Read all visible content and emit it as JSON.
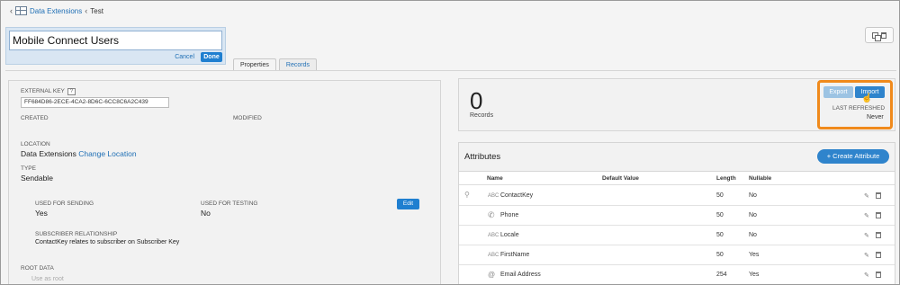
{
  "breadcrumb": {
    "parent": "Data Extensions",
    "current": "Test"
  },
  "title_editor": {
    "value": "Mobile Connect Users",
    "cancel_label": "Cancel",
    "done_label": "Done"
  },
  "tabs": [
    {
      "label": "Properties",
      "active": true
    },
    {
      "label": "Records",
      "active": false
    }
  ],
  "properties": {
    "external_key_label": "EXTERNAL KEY",
    "help_glyph": "?",
    "external_key_value": "FF684D86-2ECE-4CA2-8D6C-6CC8C6A2C439",
    "created_label": "CREATED",
    "modified_label": "MODIFIED",
    "location_label": "LOCATION",
    "location_value": "Data Extensions",
    "change_location_label": "Change Location",
    "type_label": "TYPE",
    "type_value": "Sendable",
    "used_for_sending_label": "USED FOR SENDING",
    "used_for_sending_value": "Yes",
    "used_for_testing_label": "USED FOR TESTING",
    "used_for_testing_value": "No",
    "edit_label": "Edit",
    "subscriber_rel_label": "SUBSCRIBER RELATIONSHIP",
    "subscriber_rel_value": "ContactKey relates to subscriber on Subscriber Key",
    "root_data_label": "ROOT DATA",
    "use_as_root_label": "Use as root"
  },
  "records": {
    "count": "0",
    "count_label": "Records",
    "export_label": "Export",
    "import_label": "Import",
    "last_refreshed_label": "LAST REFRESHED",
    "last_refreshed_value": "Never"
  },
  "attributes": {
    "title": "Attributes",
    "create_label": "+ Create Attribute",
    "columns": {
      "name": "Name",
      "default": "Default Value",
      "length": "Length",
      "nullable": "Nullable"
    },
    "rows": [
      {
        "name": "ContactKey",
        "type_icon": "ABC",
        "length": "50",
        "nullable": "No",
        "primary_key": true
      },
      {
        "name": "Phone",
        "type_icon": "phone",
        "length": "50",
        "nullable": "No",
        "primary_key": false
      },
      {
        "name": "Locale",
        "type_icon": "ABC",
        "length": "50",
        "nullable": "No",
        "primary_key": false
      },
      {
        "name": "FirstName",
        "type_icon": "ABC",
        "length": "50",
        "nullable": "Yes",
        "primary_key": false
      },
      {
        "name": "Email Address",
        "type_icon": "@",
        "length": "254",
        "nullable": "Yes",
        "primary_key": false
      }
    ]
  },
  "colors": {
    "accent": "#2f84cc",
    "highlight": "#f08a1c",
    "link": "#1f6fb5"
  }
}
